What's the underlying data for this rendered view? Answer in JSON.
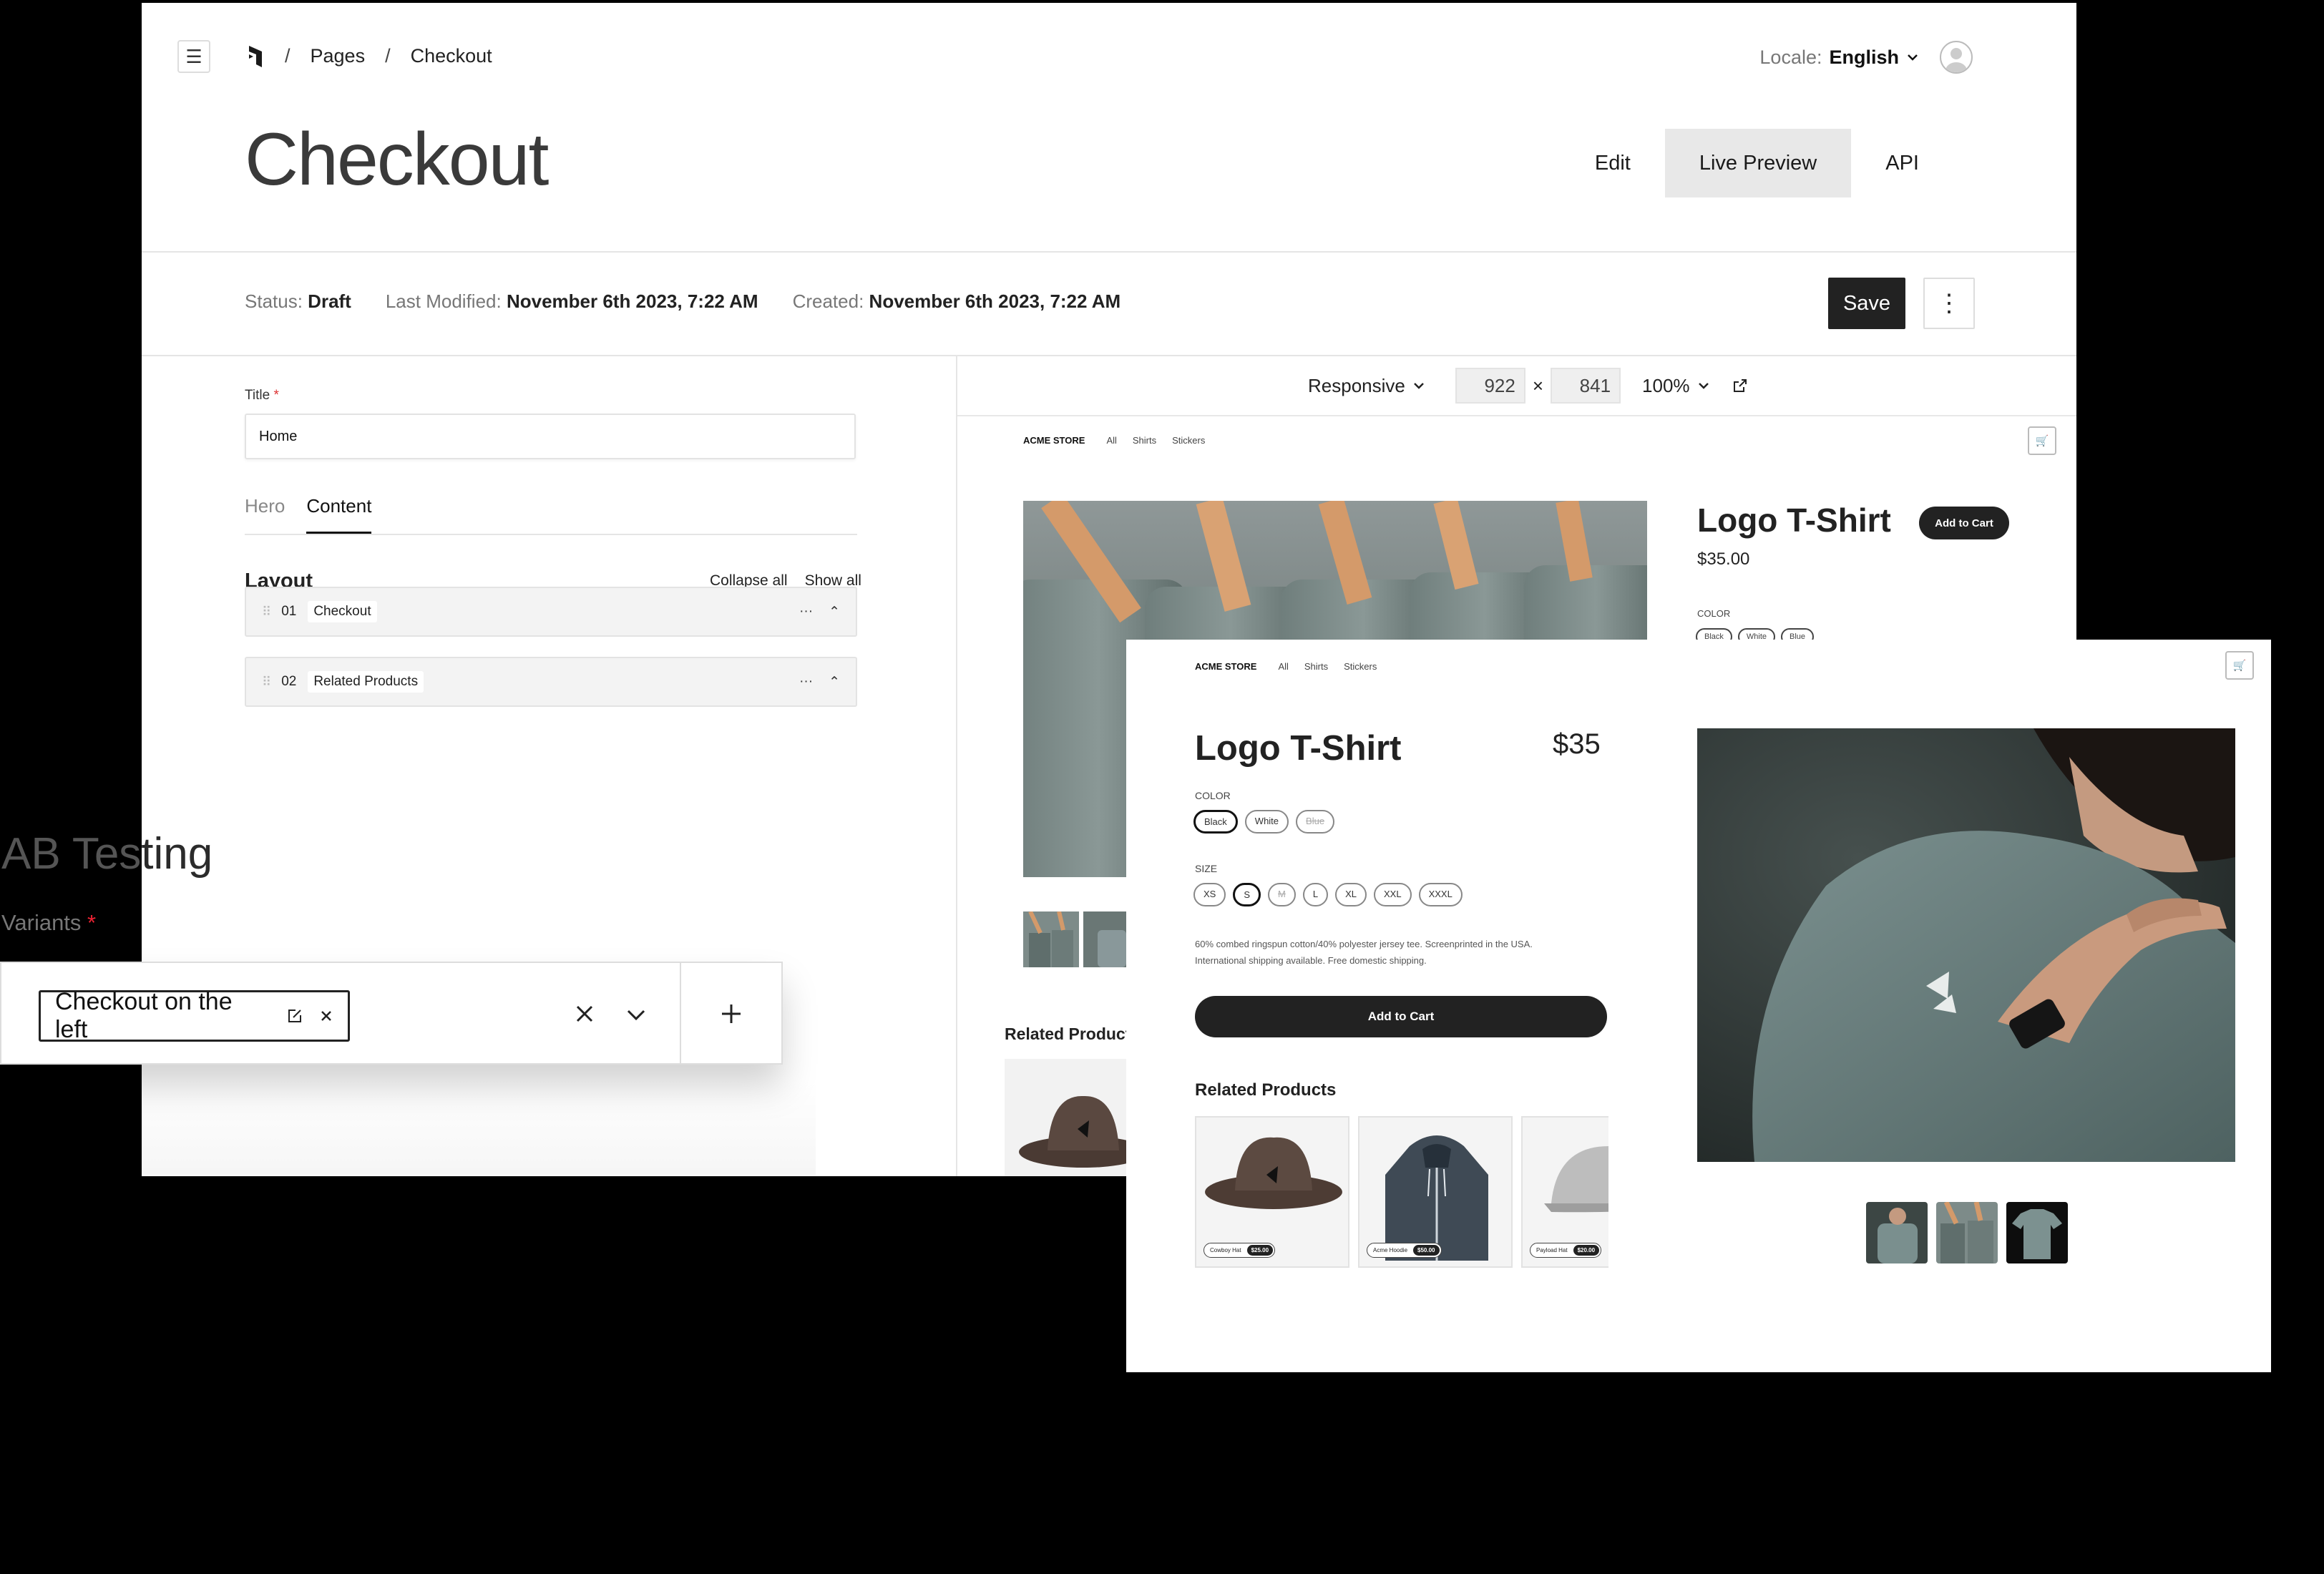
{
  "breadcrumb": {
    "section": "Pages",
    "current": "Checkout"
  },
  "locale": {
    "label": "Locale:",
    "value": "English"
  },
  "page_title": "Checkout",
  "view_tabs": [
    {
      "label": "Edit"
    },
    {
      "label": "Live Preview",
      "active": true
    },
    {
      "label": "API"
    }
  ],
  "meta": {
    "status_label": "Status:",
    "status_value": "Draft",
    "modified_label": "Last Modified:",
    "modified_value": "November 6th 2023, 7:22 AM",
    "created_label": "Created:",
    "created_value": "November 6th 2023, 7:22 AM"
  },
  "toolbar": {
    "save_label": "Save"
  },
  "editor": {
    "title_label": "Title",
    "title_value": "Home",
    "tabs": [
      "Hero",
      "Content"
    ],
    "layout_heading": "Layout",
    "collapse_all": "Collapse all",
    "show_all": "Show all",
    "blocks": [
      {
        "num": "01",
        "name": "Checkout"
      },
      {
        "num": "02",
        "name": "Related Products"
      }
    ]
  },
  "preview_toolbar": {
    "mode": "Responsive",
    "width": "922",
    "times": "×",
    "height": "841",
    "zoom": "100%"
  },
  "preview_store": {
    "brand": "ACME STORE",
    "nav": [
      "All",
      "Shirts",
      "Stickers"
    ],
    "product_title": "Logo T-Shirt",
    "price": "$35.00",
    "add_to_cart": "Add to Cart",
    "color_label": "COLOR",
    "colors": [
      "Black",
      "White",
      "Blue"
    ],
    "related_heading": "Related Products"
  },
  "ab_testing": {
    "title_dim": "AB Tes",
    "title_rest": "ting",
    "variants_label": "Variants",
    "required_mark": "*",
    "variant_name": "Checkout on the left"
  },
  "store": {
    "brand": "ACME STORE",
    "nav": [
      "All",
      "Shirts",
      "Stickers"
    ],
    "product_title": "Logo T-Shirt",
    "price": "$35",
    "color_label": "COLOR",
    "colors": [
      "Black",
      "White",
      "Blue"
    ],
    "size_label": "SIZE",
    "sizes": [
      "XS",
      "S",
      "M",
      "L",
      "XL",
      "XXL",
      "XXXL"
    ],
    "description_line1": "60% combed ringspun cotton/40% polyester jersey tee. Screenprinted in the USA.",
    "description_line2": "International shipping available. Free domestic shipping.",
    "add_to_cart": "Add to Cart",
    "related_heading": "Related Products",
    "related": [
      {
        "name": "Cowboy Hat",
        "price": "$25.00"
      },
      {
        "name": "Acme Hoodie",
        "price": "$50.00"
      },
      {
        "name": "Payload Hat",
        "price": "$20.00"
      }
    ]
  }
}
